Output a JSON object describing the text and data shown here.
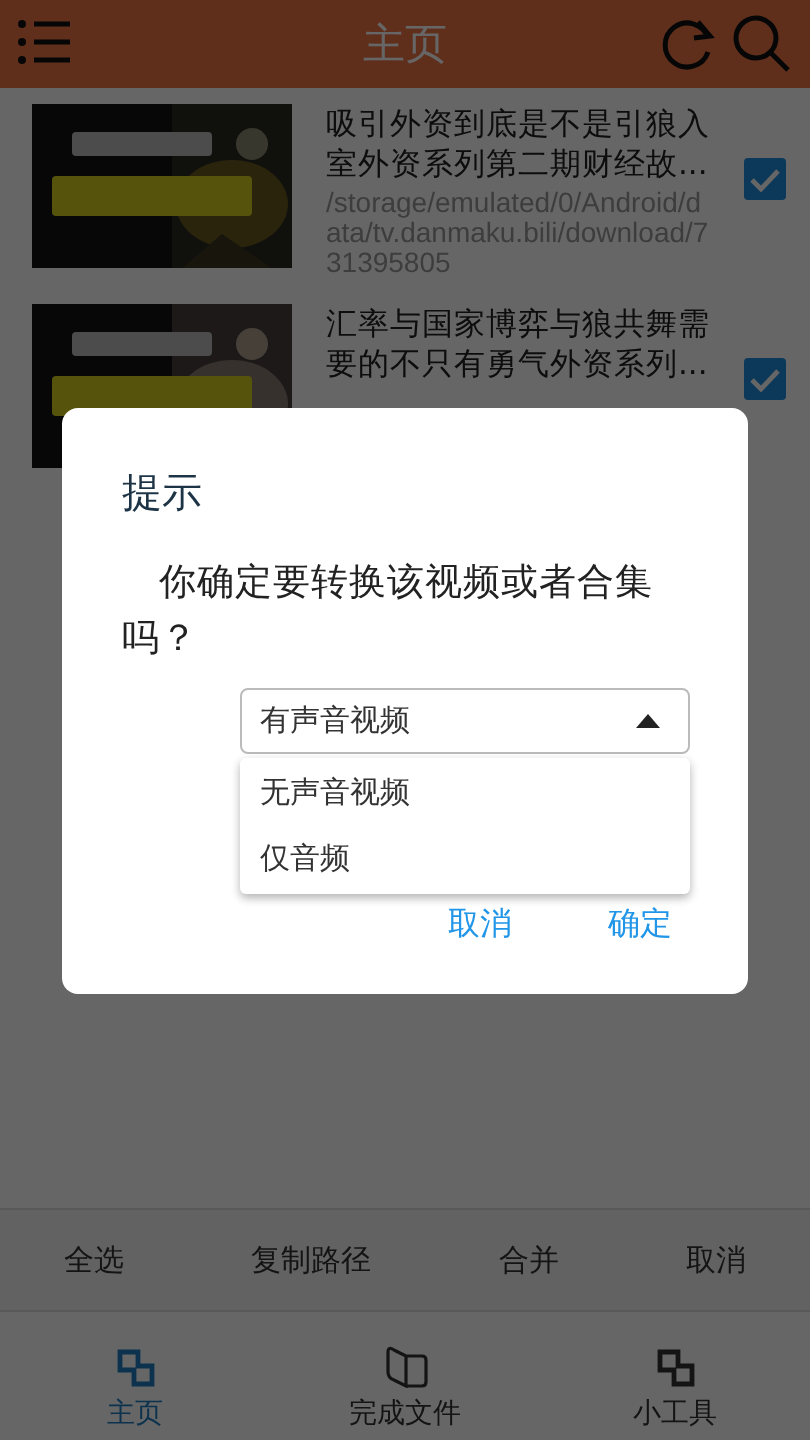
{
  "header": {
    "title": "主页"
  },
  "videos": [
    {
      "title": "吸引外资到底是不是引狼入室外资系列第二期财经故...",
      "path": "/storage/emulated/0/Android/data/tv.danmaku.bili/download/731395805",
      "checked": true
    },
    {
      "title": "汇率与国家博弈与狼共舞需要的不只有勇气外资系列...",
      "checked": true
    }
  ],
  "actions": [
    "全选",
    "复制路径",
    "合并",
    "取消"
  ],
  "nav": [
    {
      "label": "主页",
      "selected": true,
      "kind": "home"
    },
    {
      "label": "完成文件",
      "selected": false,
      "kind": "book"
    },
    {
      "label": "小工具",
      "selected": false,
      "kind": "tools"
    }
  ],
  "dialog": {
    "title": "提示",
    "message": "你确定要转换该视频或者合集吗？",
    "select": {
      "value": "有声音视频",
      "expanded": true,
      "options": [
        "无声音视频",
        "仅音频"
      ]
    },
    "buttons": [
      "取消",
      "确定"
    ]
  }
}
